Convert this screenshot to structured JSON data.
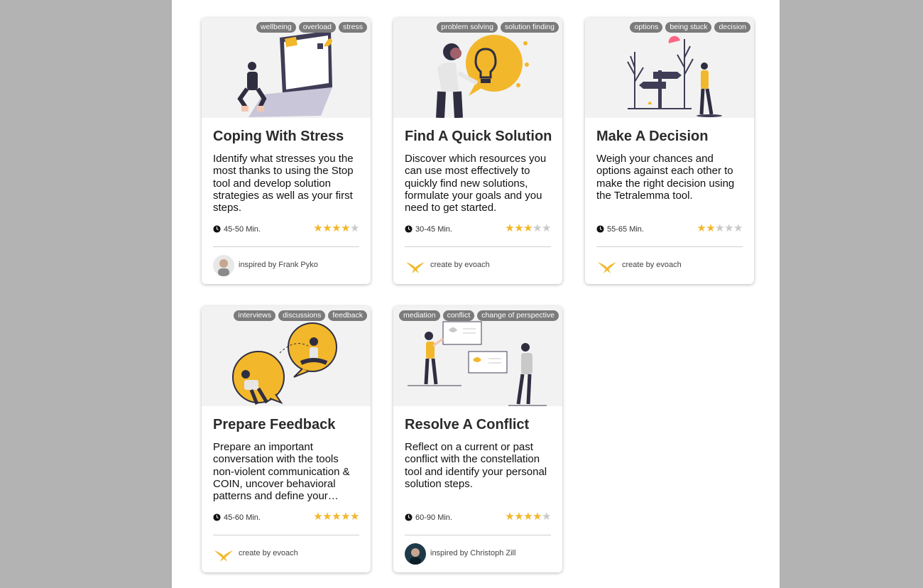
{
  "colors": {
    "accent": "#f2b72b",
    "tag_bg": "#7b7b7b",
    "star_off": "#c9c9c9",
    "backdrop": "#b3b3b3"
  },
  "cards": [
    {
      "tags": [
        "wellbeing",
        "overload",
        "stress"
      ],
      "title": "Coping With Stress",
      "description": "Identify what stresses you the most thanks to using the Stop tool and develop solution strategies as well as your first steps.",
      "duration": "45-50 Min.",
      "rating": 4,
      "rating_max": 5,
      "author": "inspired by Frank Pyko",
      "author_icon": "person-avatar"
    },
    {
      "tags": [
        "problem solving",
        "solution finding"
      ],
      "title": "Find A Quick Solution",
      "description": "Discover which resources you can use most effectively to quickly find new solutions, formulate your goals and you need to get started.",
      "duration": "30-45 Min.",
      "rating": 3,
      "rating_max": 5,
      "author": "create by evoach",
      "author_icon": "evoach-bird-logo"
    },
    {
      "tags": [
        "options",
        "being stuck",
        "decision"
      ],
      "title": "Make A Decision",
      "description": "Weigh your chances and options against each other to make the right decision using the Tetralemma tool.",
      "duration": "55-65 Min.",
      "rating": 2,
      "rating_max": 5,
      "author": "create by evoach",
      "author_icon": "evoach-bird-logo"
    },
    {
      "tags": [
        "interviews",
        "discussions",
        "feedback"
      ],
      "title": "Prepare Feedback",
      "description": "Prepare an important conversation with the tools non-violent communication & COIN, uncover behavioral patterns and define your…",
      "duration": "45-60 Min.",
      "rating": 5,
      "rating_max": 5,
      "author": "create by evoach",
      "author_icon": "evoach-bird-logo"
    },
    {
      "tags": [
        "mediation",
        "conflict",
        "change of perspective"
      ],
      "title": "Resolve A Conflict",
      "description": "Reflect on a current or past conflict with the constellation tool and identify your personal solution steps.",
      "duration": "60-90 Min.",
      "rating": 4,
      "rating_max": 5,
      "author": "inspired by Christoph Zill",
      "author_icon": "person-avatar"
    }
  ]
}
